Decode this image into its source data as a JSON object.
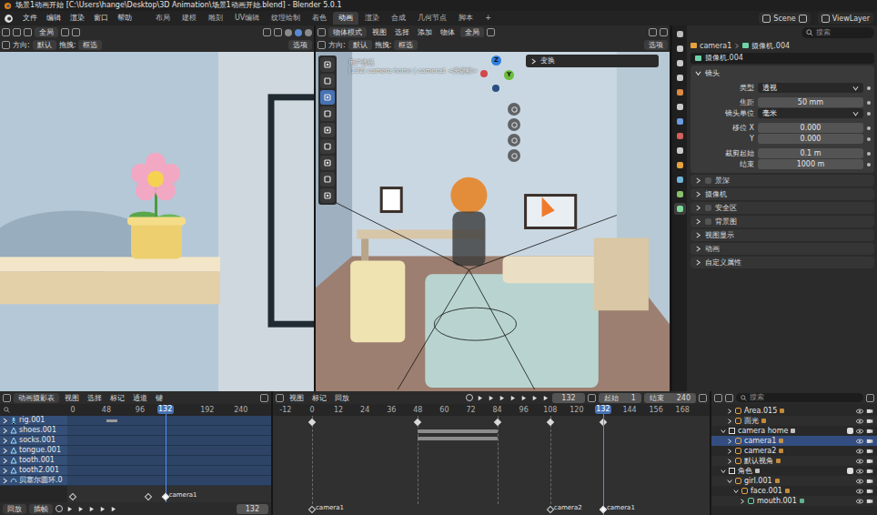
{
  "window": {
    "title": "场景1动画开始 [C:\\Users\\hange\\Desktop\\3D Animation\\场景1动画开始.blend] - Blender 5.0.1"
  },
  "menu": [
    "文件",
    "编辑",
    "渲染",
    "窗口",
    "帮助"
  ],
  "workspaces": [
    {
      "label": "布局",
      "selected": false
    },
    {
      "label": "建模",
      "selected": false
    },
    {
      "label": "雕刻",
      "selected": false
    },
    {
      "label": "UV编辑",
      "selected": false
    },
    {
      "label": "纹理绘制",
      "selected": false
    },
    {
      "label": "着色",
      "selected": false
    },
    {
      "label": "动画",
      "selected": true
    },
    {
      "label": "渲染",
      "selected": false
    },
    {
      "label": "合成",
      "selected": false
    },
    {
      "label": "几何节点",
      "selected": false
    },
    {
      "label": "脚本",
      "selected": false
    }
  ],
  "add_workspace": "+",
  "scene": "Scene",
  "view_layer": "ViewLayer",
  "left_viewport": {
    "pivot": "全局",
    "orientation_label": "方向:",
    "orientation": "默认",
    "drag_label": "拖拽:",
    "drag": "框选",
    "options": "选项"
  },
  "main_viewport": {
    "mode": "物体模式",
    "menus": [
      "视图",
      "选择",
      "添加",
      "物体"
    ],
    "pivot": "全局",
    "orientation_label": "方向:",
    "orientation": "默认",
    "drag_label": "拖拽:",
    "drag": "框选",
    "options": "选项",
    "view_name": "用户透视",
    "view_info": "(132) camera home | camera1 <关键帧>",
    "sidebar_panel": "变换",
    "axes": [
      "Z",
      "Y"
    ],
    "tools": [
      {
        "selected": false
      },
      {
        "selected": false
      },
      {
        "selected": true
      },
      {
        "selected": false
      },
      {
        "selected": false
      },
      {
        "selected": false
      },
      {
        "selected": false
      },
      {
        "selected": false
      },
      {
        "selected": false
      }
    ]
  },
  "properties": {
    "search_placeholder": "搜索",
    "object": "camera1",
    "data_name": "摄像机.004",
    "data_field": "摄像机.004",
    "section": "镜头",
    "tabs": [
      {
        "selected": false
      },
      {
        "selected": false
      },
      {
        "selected": false
      },
      {
        "selected": false
      },
      {
        "selected": false
      },
      {
        "selected": false
      },
      {
        "selected": false
      },
      {
        "selected": false
      },
      {
        "selected": false
      },
      {
        "selected": false
      },
      {
        "selected": false
      },
      {
        "selected": true
      }
    ],
    "groups": [
      [
        {
          "label": "类型",
          "value": "透视",
          "kind": "dropdown"
        }
      ],
      [
        {
          "label": "焦距",
          "value": "50 mm",
          "kind": "number"
        },
        {
          "label": "镜头单位",
          "value": "毫米",
          "kind": "dropdown"
        }
      ],
      [
        {
          "label": "移位 X",
          "value": "0.000",
          "kind": "number"
        },
        {
          "label": "Y",
          "value": "0.000",
          "kind": "number"
        }
      ],
      [
        {
          "label": "裁剪起始",
          "value": "0.1 m",
          "kind": "number"
        },
        {
          "label": "结束",
          "value": "1000 m",
          "kind": "number"
        }
      ]
    ],
    "subpanels": [
      {
        "label": "景深",
        "kind": "checkbox",
        "checked": false
      },
      {
        "label": "摄像机",
        "kind": "plain",
        "checked": false
      },
      {
        "label": "安全区",
        "kind": "checkbox",
        "checked": false
      },
      {
        "label": "背景图",
        "kind": "checkbox",
        "checked": false
      },
      {
        "label": "视图显示",
        "kind": "plain",
        "checked": false
      },
      {
        "label": "动画",
        "kind": "plain",
        "checked": false
      },
      {
        "label": "自定义属性",
        "kind": "plain",
        "checked": false
      }
    ]
  },
  "dopesheet": {
    "editor": "动画摄影表",
    "menus": [
      "视图",
      "选择",
      "标记",
      "通道",
      "键"
    ],
    "ticks": [
      "0",
      "48",
      "96",
      "192",
      "240"
    ],
    "current_frame": "132",
    "channels": [
      {
        "name": "rig.001",
        "kind": "armature",
        "selected": true
      },
      {
        "name": "shoes.001",
        "kind": "mesh",
        "selected": true
      },
      {
        "name": "socks.001",
        "kind": "mesh",
        "selected": true
      },
      {
        "name": "tongue.001",
        "kind": "mesh",
        "selected": true
      },
      {
        "name": "tooth.001",
        "kind": "mesh",
        "selected": true
      },
      {
        "name": "tooth2.001",
        "kind": "mesh",
        "selected": true
      },
      {
        "name": "贝塞尔圆环.0",
        "kind": "curve",
        "selected": true
      }
    ],
    "keys": [
      {
        "row": 0,
        "from": 48,
        "to": 64
      }
    ],
    "markers": [
      {
        "frame": 0,
        "selected": false
      },
      {
        "frame": 108,
        "selected": false
      },
      {
        "frame": 132,
        "label": "camera1",
        "selected": true
      }
    ],
    "footer": {
      "playback": "回放",
      "keying": "插帧",
      "frame": "132"
    }
  },
  "timeline": {
    "menus": [
      "视图",
      "标记",
      "回放"
    ],
    "frame_field": "132",
    "start_label": "起始",
    "start": "1",
    "end_label": "结束",
    "end": "240",
    "ticks": [
      "-12",
      "0",
      "12",
      "24",
      "36",
      "48",
      "60",
      "72",
      "84",
      "96",
      "108",
      "120",
      "144",
      "156",
      "168"
    ],
    "current_frame": "132",
    "keys": [
      0,
      48,
      84,
      108,
      132
    ],
    "holds": [
      [
        48,
        84
      ]
    ],
    "markers": [
      {
        "label": "camera1",
        "frame": 0,
        "selected": false
      },
      {
        "label": "camera2",
        "frame": 108,
        "selected": false
      },
      {
        "label": "camera1",
        "frame": 132,
        "selected": true
      }
    ]
  },
  "outliner": {
    "search_placeholder": "搜索",
    "items": [
      {
        "name": "Area.015",
        "kind": "light",
        "depth": 2,
        "expandable": true,
        "expanded": false,
        "selected": false
      },
      {
        "name": "面光",
        "kind": "light",
        "depth": 2,
        "expandable": true,
        "expanded": false,
        "selected": false
      },
      {
        "name": "camera home",
        "kind": "collection",
        "depth": 1,
        "expandable": true,
        "expanded": true,
        "selected": false
      },
      {
        "name": "camera1",
        "kind": "camera",
        "depth": 2,
        "expandable": true,
        "expanded": false,
        "selected": true
      },
      {
        "name": "camera2",
        "kind": "camera",
        "depth": 2,
        "expandable": true,
        "expanded": false,
        "selected": false
      },
      {
        "name": "默认视角",
        "kind": "camera",
        "depth": 2,
        "expandable": true,
        "expanded": false,
        "selected": false
      },
      {
        "name": "角色",
        "kind": "collection",
        "depth": 1,
        "expandable": true,
        "expanded": true,
        "selected": false
      },
      {
        "name": "girl.001",
        "kind": "object",
        "depth": 2,
        "expandable": true,
        "expanded": true,
        "selected": false
      },
      {
        "name": "face.001",
        "kind": "object",
        "depth": 3,
        "expandable": true,
        "expanded": true,
        "selected": false
      },
      {
        "name": "mouth.001",
        "kind": "mesh",
        "depth": 4,
        "expandable": true,
        "expanded": false,
        "selected": false
      }
    ]
  }
}
